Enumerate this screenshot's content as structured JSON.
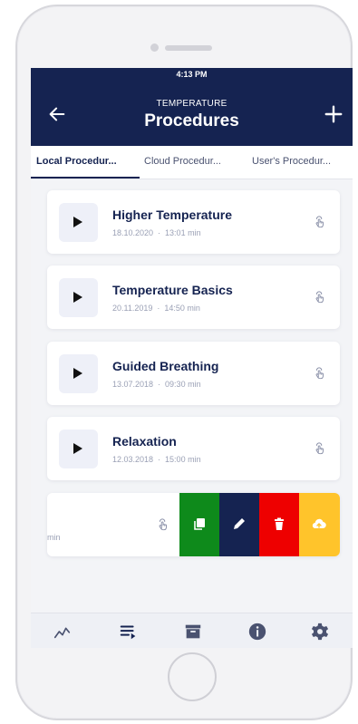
{
  "status_bar": {
    "time": "4:13 PM"
  },
  "header": {
    "overline": "TEMPERATURE",
    "title": "Procedures"
  },
  "tabs": [
    {
      "label": "Local Procedur...",
      "active": true
    },
    {
      "label": "Cloud Procedur...",
      "active": false
    },
    {
      "label": "User's Procedur...",
      "active": false
    }
  ],
  "procedures": [
    {
      "title": "Higher Temperature",
      "date": "18.10.2020",
      "duration": "13:01 min"
    },
    {
      "title": "Temperature Basics",
      "date": "20.11.2019",
      "duration": "14:50 min"
    },
    {
      "title": "Guided Breathing",
      "date": "13.07.2018",
      "duration": "09:30 min"
    },
    {
      "title": "Relaxation",
      "date": "12.03.2018",
      "duration": "15:00 min"
    }
  ],
  "swiped_item": {
    "meta_fragment": "min"
  },
  "swipe_actions": {
    "copy_color": "#0e8a1b",
    "edit_color": "#152351",
    "delete_color": "#ee0000",
    "upload_color": "#ffc42b"
  },
  "bottom_nav": [
    "chart-icon",
    "playlist-icon",
    "archive-icon",
    "info-icon",
    "gear-icon"
  ],
  "colors": {
    "primary": "#152351",
    "background": "#f3f4f7"
  }
}
